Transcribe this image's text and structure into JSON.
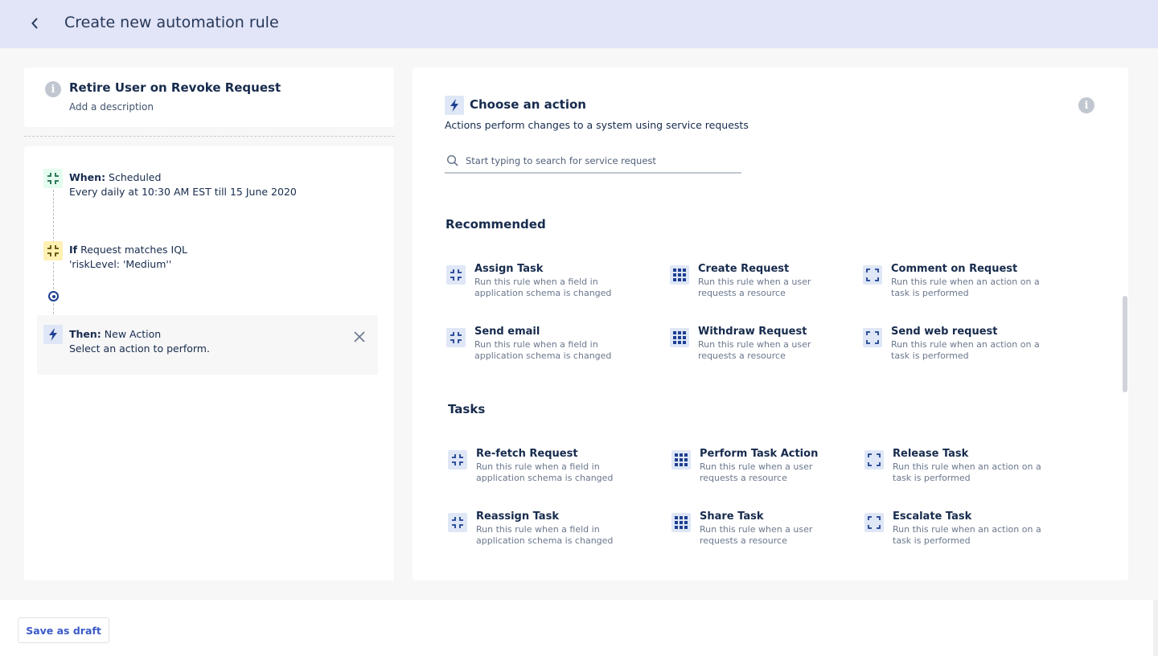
{
  "header": {
    "title": "Create new automation rule",
    "back_icon": "chevron-left-icon"
  },
  "rule": {
    "name": "Retire User on Revoke Request",
    "description_placeholder": "Add a description",
    "info_icon": "info-icon"
  },
  "flow": {
    "when": {
      "label": "When:",
      "value": "Scheduled",
      "detail": "Every daily at 10:30 AM EST till 15 June 2020",
      "icon": "collapse-icon",
      "color": "#e3fcef"
    },
    "if": {
      "label": "If",
      "value": "Request matches IQL",
      "detail": "'riskLevel: 'Medium''",
      "icon": "collapse-icon",
      "color": "#fff0b3"
    },
    "then": {
      "label": "Then:",
      "value": "New Action",
      "detail": "Select an action to perform.",
      "icon": "lightning-icon",
      "color": "#dfe7f7"
    }
  },
  "actions_panel": {
    "title": "Choose an action",
    "subtitle": "Actions perform changes to a system using service requests",
    "search_placeholder": "Start typing to search for service request",
    "sections": [
      {
        "title": "Recommended",
        "items": [
          {
            "name": "Assign Task",
            "desc": "Run this rule when a field in application schema is changed",
            "icon": "collapse-icon"
          },
          {
            "name": "Create Request",
            "desc": "Run this rule when a user requests a resource",
            "icon": "grid-icon"
          },
          {
            "name": "Comment on Request",
            "desc": "Run this rule when an action on a task is performed",
            "icon": "expand-icon"
          },
          {
            "name": "Send email",
            "desc": "Run this rule when a field in application schema is changed",
            "icon": "collapse-icon"
          },
          {
            "name": "Withdraw Request",
            "desc": "Run this rule when a user requests a resource",
            "icon": "grid-icon"
          },
          {
            "name": "Send web request",
            "desc": "Run this rule when an action on a task is performed",
            "icon": "expand-icon"
          }
        ]
      },
      {
        "title": "Tasks",
        "items": [
          {
            "name": "Re-fetch Request",
            "desc": "Run this rule when a field in application schema is changed",
            "icon": "collapse-icon"
          },
          {
            "name": "Perform Task Action",
            "desc": "Run this rule when a user requests a resource",
            "icon": "grid-icon"
          },
          {
            "name": "Release Task",
            "desc": "Run this rule when an action on a task is performed",
            "icon": "expand-icon"
          },
          {
            "name": "Reassign Task",
            "desc": "Run this rule when a field in application schema is changed",
            "icon": "collapse-icon"
          },
          {
            "name": "Share Task",
            "desc": "Run this rule when a user requests a resource",
            "icon": "grid-icon"
          },
          {
            "name": "Escalate Task",
            "desc": "Run this rule when an action on a task is performed",
            "icon": "expand-icon"
          }
        ]
      }
    ]
  },
  "footer": {
    "save_draft_label": "Save as draft"
  },
  "colors": {
    "header_bg": "#e2e4f8",
    "accent": "#3a5ac8",
    "icon_blue": "#1d3f91"
  }
}
